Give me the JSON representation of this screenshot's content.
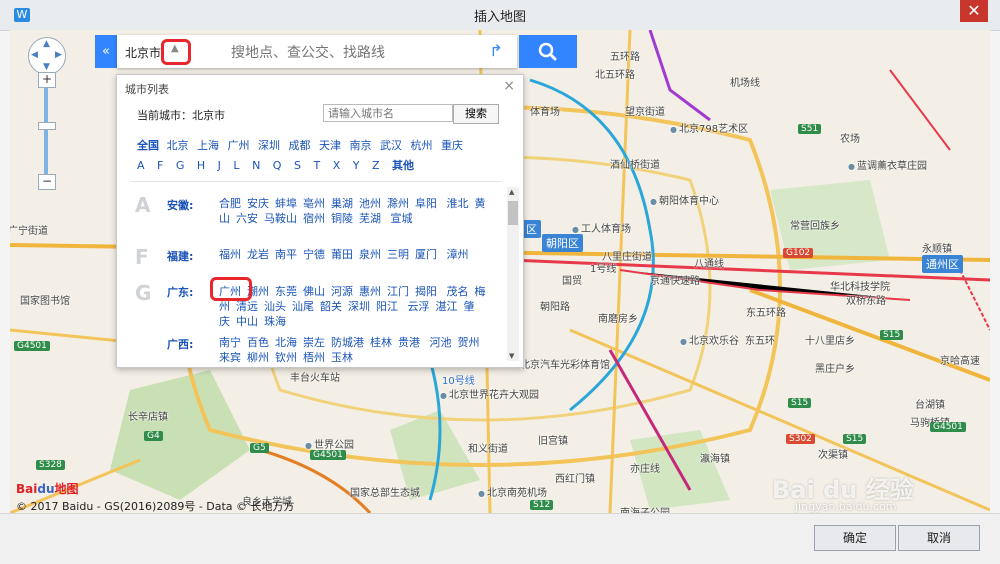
{
  "window": {
    "title": "插入地图",
    "close_glyph": "✕",
    "app_icon": "W"
  },
  "map_labels": [
    {
      "text": "五环路",
      "cls": ""
    },
    {
      "text": "北五环路",
      "cls": ""
    },
    {
      "text": "体育场",
      "cls": ""
    },
    {
      "text": "望京街道",
      "cls": ""
    },
    {
      "text": "酒仙桥街道",
      "cls": ""
    },
    {
      "text": "北京798艺术区",
      "cls": "poi"
    },
    {
      "text": "蓝调薰衣草庄园",
      "cls": "poi"
    },
    {
      "text": "工人体育场",
      "cls": "poi"
    },
    {
      "text": "朝阳体育中心",
      "cls": "poi"
    },
    {
      "text": "常营回族乡",
      "cls": ""
    },
    {
      "text": "八里庄街道",
      "cls": ""
    },
    {
      "text": "永顺镇",
      "cls": ""
    },
    {
      "text": "国贸",
      "cls": ""
    },
    {
      "text": "朝阳路",
      "cls": ""
    },
    {
      "text": "京通快速路",
      "cls": ""
    },
    {
      "text": "国家图书馆",
      "cls": ""
    },
    {
      "text": "华北科技学院",
      "cls": ""
    },
    {
      "text": "南磨房乡",
      "cls": ""
    },
    {
      "text": "北京欢乐谷",
      "cls": "poi"
    },
    {
      "text": "十八里店乡",
      "cls": ""
    },
    {
      "text": "黑庄户乡",
      "cls": ""
    },
    {
      "text": "丰台火车站",
      "cls": ""
    },
    {
      "text": "北京汽车光彩体育馆",
      "cls": ""
    },
    {
      "text": "北京世界花卉大观园",
      "cls": "poi"
    },
    {
      "text": "长辛店镇",
      "cls": ""
    },
    {
      "text": "世界公园",
      "cls": "poi"
    },
    {
      "text": "和义街道",
      "cls": ""
    },
    {
      "text": "旧宫镇",
      "cls": ""
    },
    {
      "text": "瀛海镇",
      "cls": ""
    },
    {
      "text": "北京南苑机场",
      "cls": "poi"
    },
    {
      "text": "台湖镇",
      "cls": ""
    },
    {
      "text": "次渠镇",
      "cls": ""
    },
    {
      "text": "南海子公园",
      "cls": ""
    },
    {
      "text": "良乡大学城",
      "cls": ""
    },
    {
      "text": "广宁街道",
      "cls": ""
    },
    {
      "text": "东五环路",
      "cls": ""
    },
    {
      "text": "机场线",
      "cls": ""
    },
    {
      "text": "八通线",
      "cls": ""
    },
    {
      "text": "亦庄线",
      "cls": ""
    },
    {
      "text": "10号线",
      "cls": "blue"
    },
    {
      "text": "1号线",
      "cls": ""
    },
    {
      "text": "东五环",
      "cls": ""
    },
    {
      "text": "农场",
      "cls": ""
    },
    {
      "text": "双桥东路",
      "cls": ""
    },
    {
      "text": "国家总部生态城",
      "cls": ""
    },
    {
      "text": "马驹桥镇",
      "cls": ""
    },
    {
      "text": "京哈高速",
      "cls": ""
    },
    {
      "text": "西红门镇",
      "cls": ""
    }
  ],
  "route_badges": [
    {
      "text": "S51",
      "cls": ""
    },
    {
      "text": "G102",
      "cls": "red"
    },
    {
      "text": "S15",
      "cls": ""
    },
    {
      "text": "S15",
      "cls": ""
    },
    {
      "text": "G4501",
      "cls": ""
    },
    {
      "text": "S302",
      "cls": "red"
    },
    {
      "text": "S15",
      "cls": ""
    },
    {
      "text": "G4501",
      "cls": ""
    },
    {
      "text": "G4",
      "cls": ""
    },
    {
      "text": "S328",
      "cls": ""
    },
    {
      "text": "G5",
      "cls": ""
    },
    {
      "text": "S12",
      "cls": ""
    },
    {
      "text": "G4501",
      "cls": ""
    }
  ],
  "districts": [
    {
      "text": "朝阳区"
    },
    {
      "text": "通州区"
    },
    {
      "text": "区"
    }
  ],
  "map_controls": {
    "pan_up": "▲",
    "pan_down": "▼",
    "pan_left": "◀",
    "pan_right": "▶",
    "zoom_in": "+",
    "zoom_out": "−",
    "collapse": "«"
  },
  "search": {
    "city_label": "北京市",
    "city_toggle_glyph": "▲",
    "placeholder": "搜地点、查公交、找路线",
    "route_glyph": "↱"
  },
  "city_panel": {
    "title": "城市列表",
    "close_glyph": "×",
    "current_city_label": "当前城市：北京市",
    "input_placeholder": "请输入城市名",
    "search_button": "搜索",
    "hot_head": "全国",
    "hot_cities": [
      "北京",
      "上海",
      "广州",
      "深圳",
      "成都",
      "天津",
      "南京",
      "武汉",
      "杭州",
      "重庆"
    ],
    "letters": [
      "A",
      "F",
      "G",
      "H",
      "J",
      "L",
      "N",
      "Q",
      "S",
      "T",
      "X",
      "Y",
      "Z"
    ],
    "other_label": "其他",
    "scroll_up": "▲",
    "scroll_down": "▼",
    "provinces": [
      {
        "letter": "A",
        "name": "安徽:",
        "cities": [
          "合肥",
          "安庆",
          "蚌埠",
          "亳州",
          "巢湖",
          "池州",
          "滁州",
          "阜阳",
          "淮北",
          "黄山",
          "六安",
          "马鞍山",
          "宿州",
          "铜陵",
          "芜湖",
          "宣城"
        ]
      },
      {
        "letter": "F",
        "name": "福建:",
        "cities": [
          "福州",
          "龙岩",
          "南平",
          "宁德",
          "莆田",
          "泉州",
          "三明",
          "厦门",
          "漳州"
        ]
      },
      {
        "letter": "G",
        "name": "广东:",
        "cities": [
          "广州",
          "潮州",
          "东莞",
          "佛山",
          "河源",
          "惠州",
          "江门",
          "揭阳",
          "茂名",
          "梅州",
          "清远",
          "汕头",
          "汕尾",
          "韶关",
          "深圳",
          "阳江",
          "云浮",
          "湛江",
          "肇庆",
          "中山",
          "珠海"
        ]
      },
      {
        "letter": "",
        "name": "广西:",
        "cities": [
          "南宁",
          "百色",
          "北海",
          "崇左",
          "防城港",
          "桂林",
          "贵港",
          "河池",
          "贺州",
          "来宾",
          "柳州",
          "钦州",
          "梧州",
          "玉林"
        ]
      }
    ]
  },
  "branding": {
    "logo_bai": "Bai",
    "logo_du": "du",
    "logo_suffix": "地图",
    "copyright": "© 2017 Baidu - GS(2016)2089号 - Data © 长地万方",
    "watermark": "Bai du 经验",
    "watermark_url": "jingyan.baidu.com"
  },
  "buttons": {
    "ok": "确定",
    "cancel": "取消"
  }
}
